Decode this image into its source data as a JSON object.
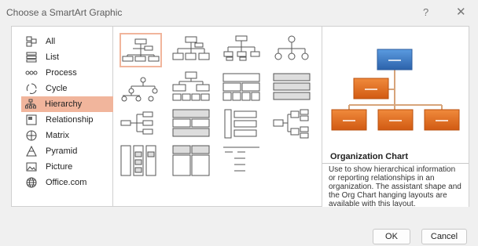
{
  "dialog": {
    "title": "Choose a SmartArt Graphic",
    "help_label": "?",
    "close_label": "✕"
  },
  "categories": [
    {
      "label": "All",
      "icon": "all-icon"
    },
    {
      "label": "List",
      "icon": "list-icon"
    },
    {
      "label": "Process",
      "icon": "process-icon"
    },
    {
      "label": "Cycle",
      "icon": "cycle-icon"
    },
    {
      "label": "Hierarchy",
      "icon": "hierarchy-icon",
      "selected": true
    },
    {
      "label": "Relationship",
      "icon": "relationship-icon"
    },
    {
      "label": "Matrix",
      "icon": "matrix-icon"
    },
    {
      "label": "Pyramid",
      "icon": "pyramid-icon"
    },
    {
      "label": "Picture",
      "icon": "picture-icon"
    },
    {
      "label": "Office.com",
      "icon": "globe-icon"
    }
  ],
  "selection_color": "#f1b59c",
  "preview": {
    "title": "Organization Chart",
    "description": "Use to show hierarchical information or reporting relationships in an organization. The assistant shape and the Org Chart hanging layouts are available with this layout.",
    "top_color": "#3a78c2",
    "box_color": "#e56a1f"
  },
  "buttons": {
    "ok": "OK",
    "cancel": "Cancel"
  }
}
